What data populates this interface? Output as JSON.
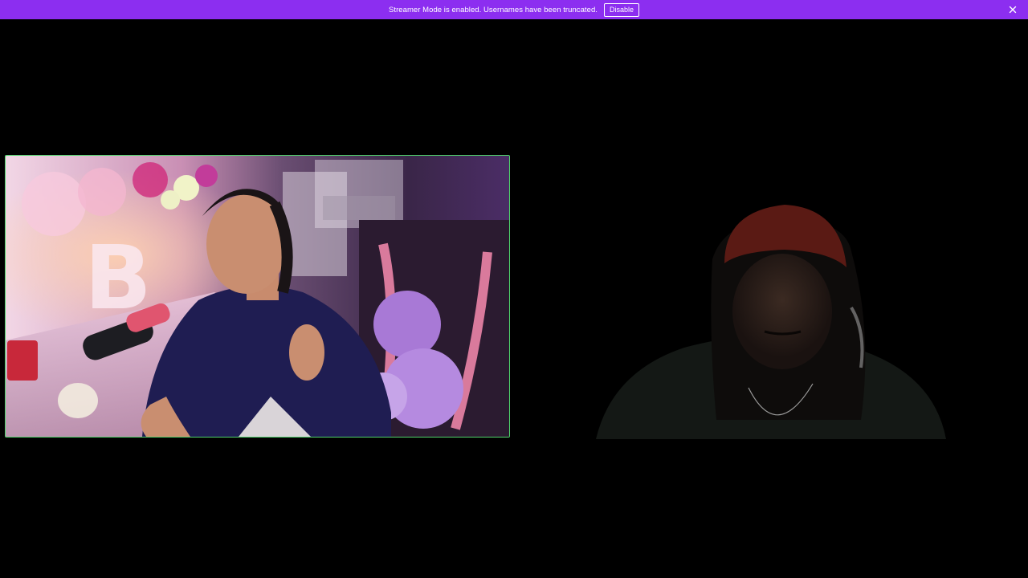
{
  "banner": {
    "message": "Streamer Mode is enabled. Usernames have been truncated.",
    "disable_label": "Disable",
    "close_icon": "close-icon",
    "background_color": "#8c2ef0"
  },
  "participants": [
    {
      "id": "participant-1",
      "speaking": true,
      "speaking_border_color": "#4fd36b"
    },
    {
      "id": "participant-2",
      "speaking": false
    }
  ]
}
